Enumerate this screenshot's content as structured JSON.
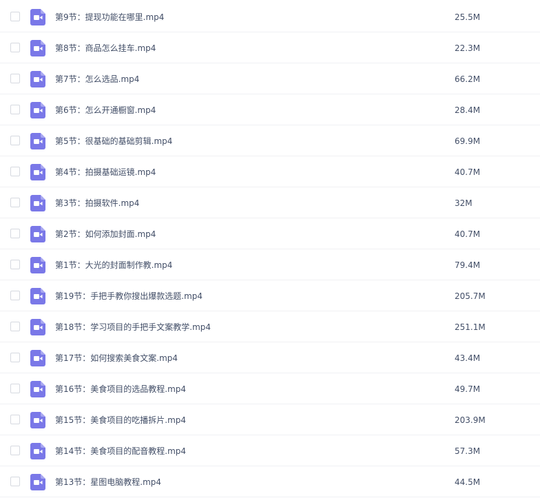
{
  "files": [
    {
      "name": "第9节：提现功能在哪里.mp4",
      "size": "25.5M",
      "icon": "video-file-icon"
    },
    {
      "name": "第8节：商品怎么挂车.mp4",
      "size": "22.3M",
      "icon": "video-file-icon"
    },
    {
      "name": "第7节：怎么选品.mp4",
      "size": "66.2M",
      "icon": "video-file-icon"
    },
    {
      "name": "第6节：怎么开通橱窗.mp4",
      "size": "28.4M",
      "icon": "video-file-icon"
    },
    {
      "name": "第5节：很基础的基础剪辑.mp4",
      "size": "69.9M",
      "icon": "video-file-icon"
    },
    {
      "name": "第4节：拍摄基础运镜.mp4",
      "size": "40.7M",
      "icon": "video-file-icon"
    },
    {
      "name": "第3节：拍摄软件.mp4",
      "size": "32M",
      "icon": "video-file-icon"
    },
    {
      "name": "第2节：如何添加封面.mp4",
      "size": "40.7M",
      "icon": "video-file-icon"
    },
    {
      "name": "第1节：大光的封面制作教.mp4",
      "size": "79.4M",
      "icon": "video-file-icon"
    },
    {
      "name": "第19节：手把手教你搜出爆款选题.mp4",
      "size": "205.7M",
      "icon": "video-file-icon"
    },
    {
      "name": "第18节：学习项目的手把手文案教学.mp4",
      "size": "251.1M",
      "icon": "video-file-icon"
    },
    {
      "name": "第17节：如何搜索美食文案.mp4",
      "size": "43.4M",
      "icon": "video-file-icon"
    },
    {
      "name": "第16节：美食项目的选品教程.mp4",
      "size": "49.7M",
      "icon": "video-file-icon"
    },
    {
      "name": "第15节：美食项目的吃播拆片.mp4",
      "size": "203.9M",
      "icon": "video-file-icon"
    },
    {
      "name": "第14节：美食项目的配音教程.mp4",
      "size": "57.3M",
      "icon": "video-file-icon"
    },
    {
      "name": "第13节：星图电脑教程.mp4",
      "size": "44.5M",
      "icon": "video-file-icon"
    }
  ],
  "colors": {
    "icon_accent": "#7a78e8",
    "text": "#424e67",
    "row_divider": "#f0f1f4"
  }
}
